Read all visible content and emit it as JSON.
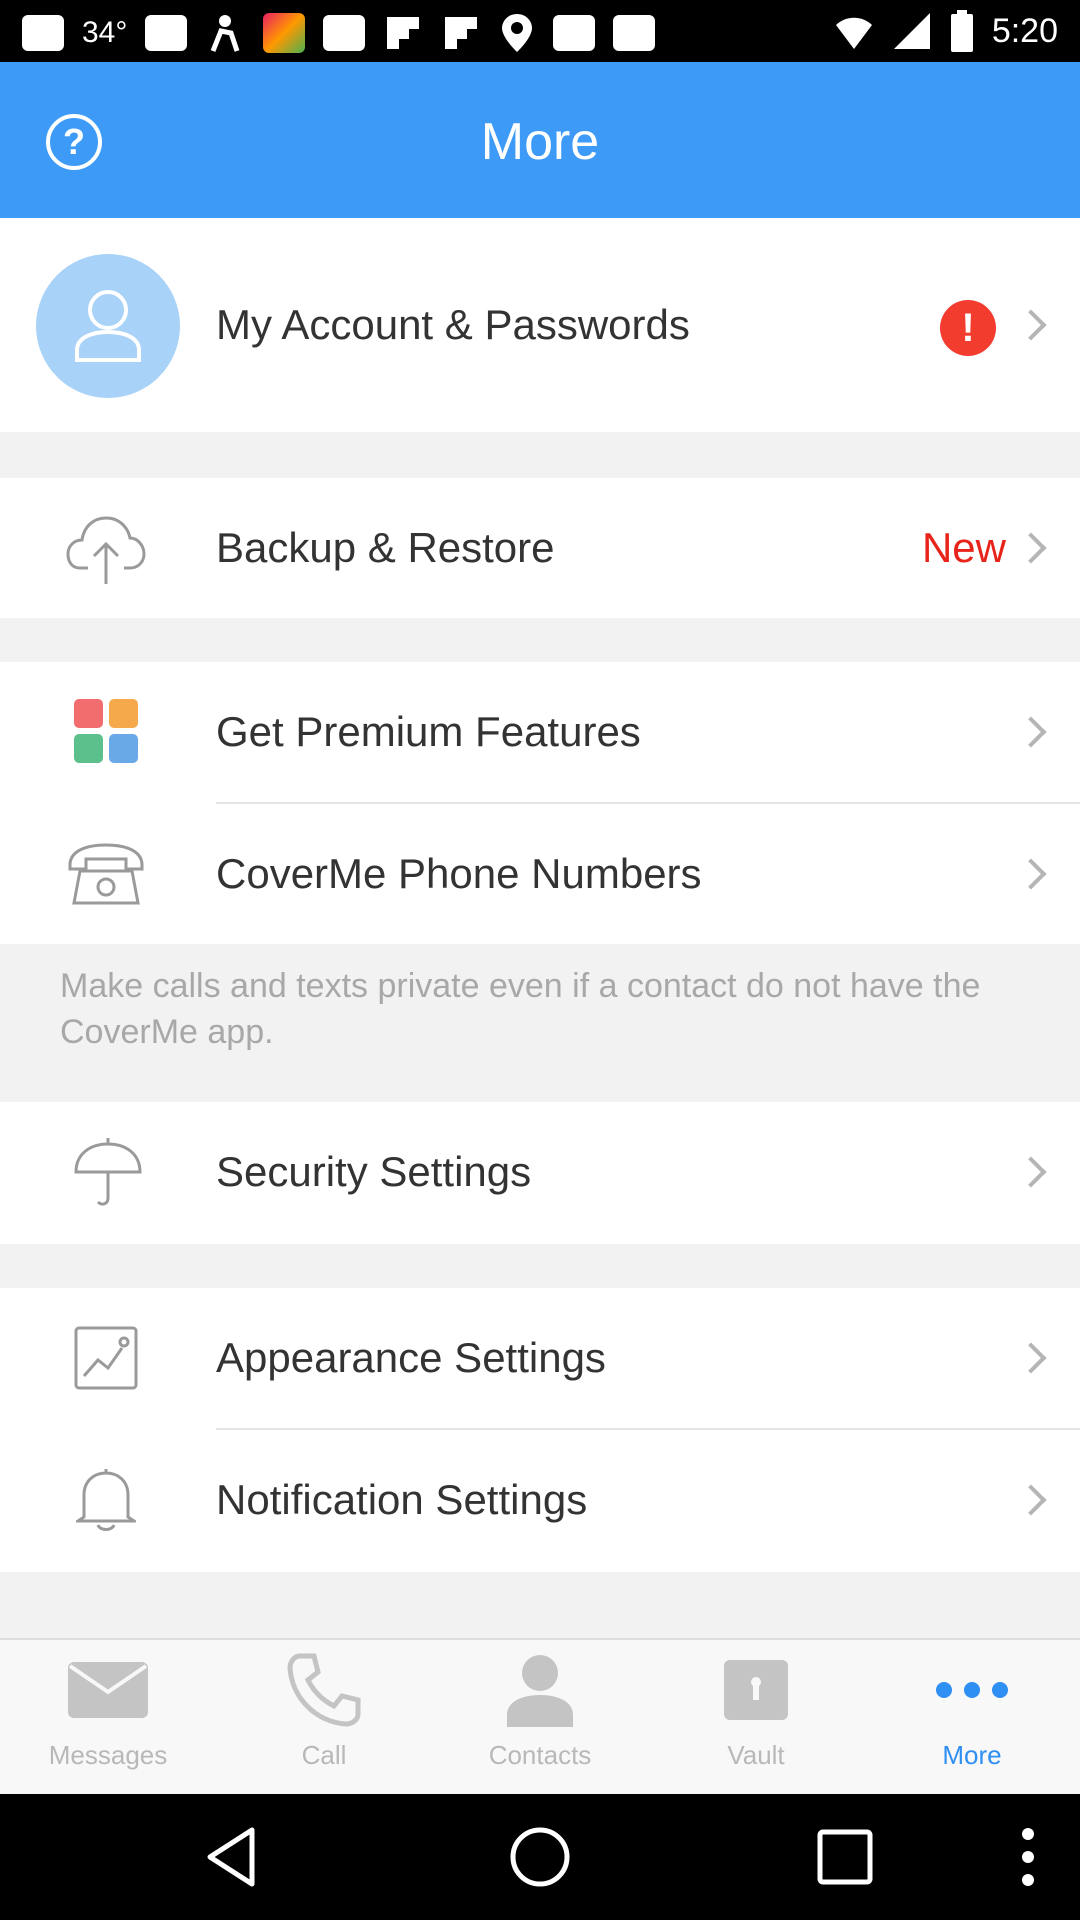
{
  "status_bar": {
    "temperature": "34°",
    "time": "5:20"
  },
  "header": {
    "title": "More",
    "help_label": "?"
  },
  "account": {
    "label": "My Account & Passwords",
    "alert": "!"
  },
  "backup": {
    "label": "Backup & Restore",
    "badge": "New"
  },
  "premium": {
    "label": "Get Premium Features"
  },
  "phone_numbers": {
    "label": "CoverMe Phone Numbers"
  },
  "note": "Make calls and texts private even if a contact do not have the CoverMe app.",
  "security": {
    "label": "Security Settings"
  },
  "appearance": {
    "label": "Appearance Settings"
  },
  "notification": {
    "label": "Notification Settings"
  },
  "tabs": [
    {
      "label": "Messages",
      "icon": "envelope-icon"
    },
    {
      "label": "Call",
      "icon": "phone-icon"
    },
    {
      "label": "Contacts",
      "icon": "person-icon"
    },
    {
      "label": "Vault",
      "icon": "vault-icon"
    },
    {
      "label": "More",
      "icon": "more-icon",
      "active": true
    }
  ],
  "colors": {
    "accent": "#3d9bf7",
    "alert": "#f23c2e",
    "new": "#e8241a"
  }
}
